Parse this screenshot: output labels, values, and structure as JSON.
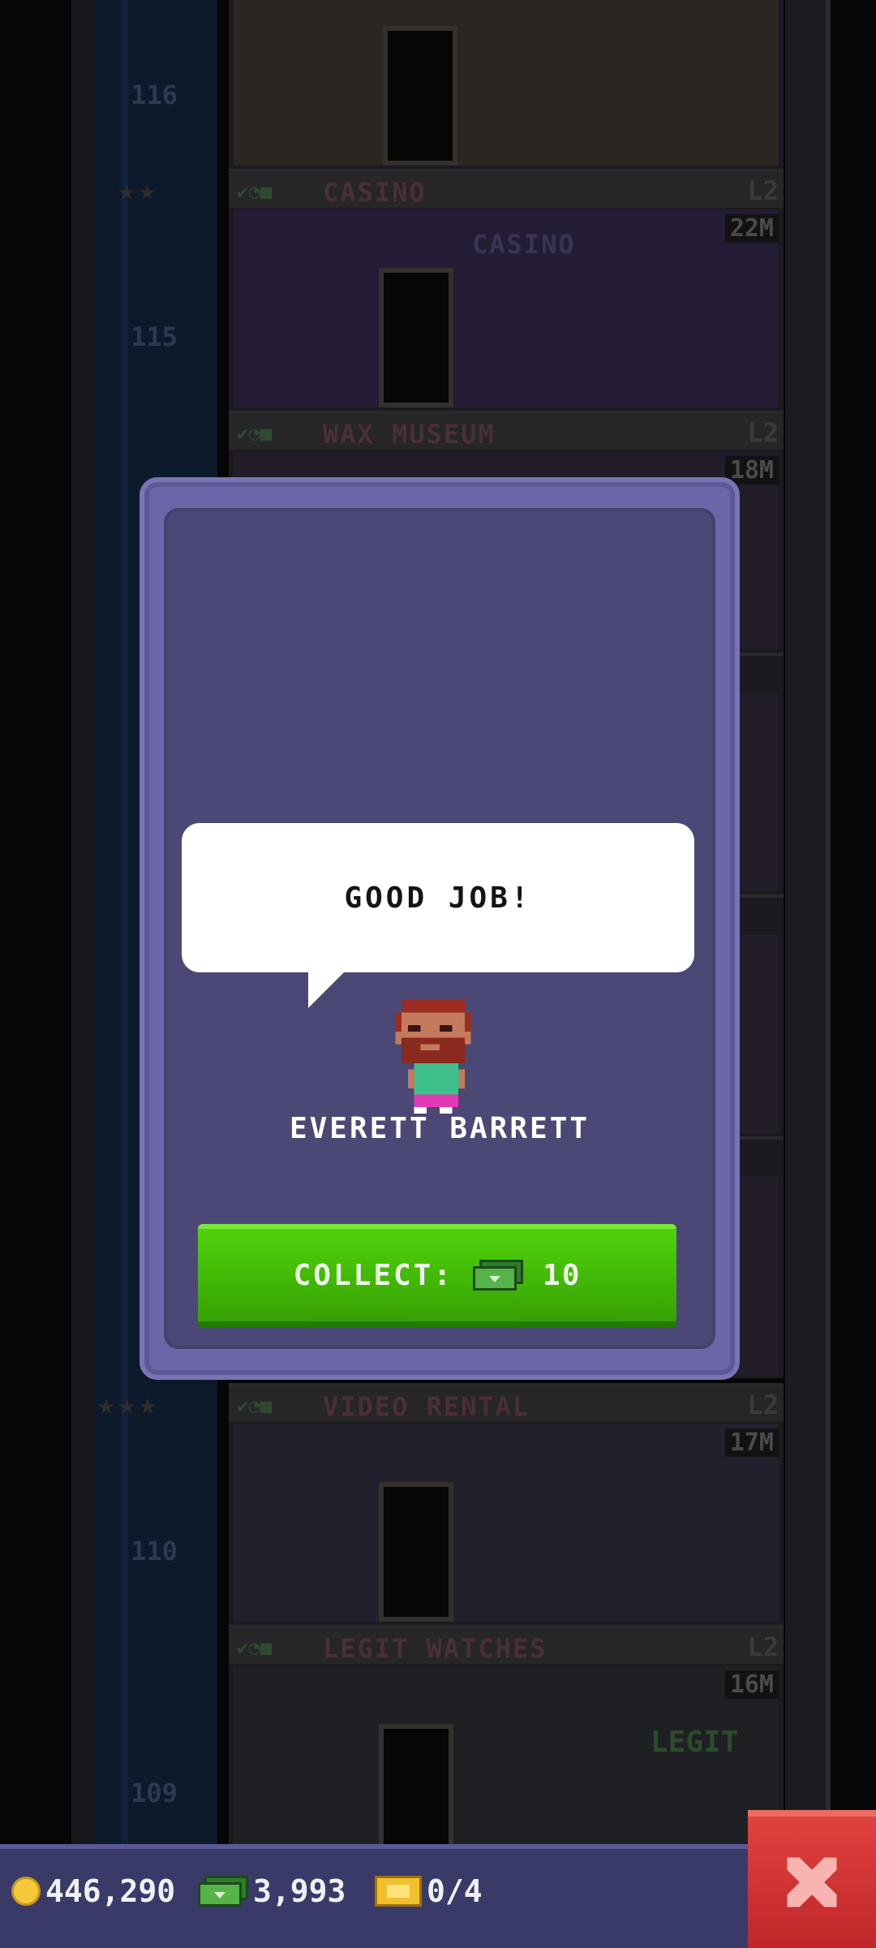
{
  "tower": {
    "floors": [
      {
        "number": "116",
        "name": "",
        "level": "",
        "cost": ""
      },
      {
        "number": "115",
        "name": "CASINO",
        "level": "L2",
        "cost": "22M",
        "sign": "CASINO"
      },
      {
        "number": "",
        "name": "WAX MUSEUM",
        "level": "L2",
        "cost": "18M"
      },
      {
        "number": "110",
        "name": "VIDEO RENTAL",
        "level": "L2",
        "cost": "17M"
      },
      {
        "number": "109",
        "name": "LEGIT WATCHES",
        "level": "L2",
        "cost": "16M",
        "sign": "LEGIT"
      }
    ]
  },
  "dialog": {
    "speech": "GOOD JOB!",
    "character_name": "EVERETT BARRETT",
    "collect_label": "COLLECT:",
    "collect_amount": "10",
    "collect_icon": "cash-icon"
  },
  "statusbar": {
    "coins": "446,290",
    "bux": "3,993",
    "tickets": "0/4"
  },
  "colors": {
    "collect_button": "#42b806",
    "close_button": "#d0302e",
    "dialog_frame": "#6a66a8",
    "dialog_panel": "#4b4876",
    "statusbar": "#3a3a68"
  }
}
